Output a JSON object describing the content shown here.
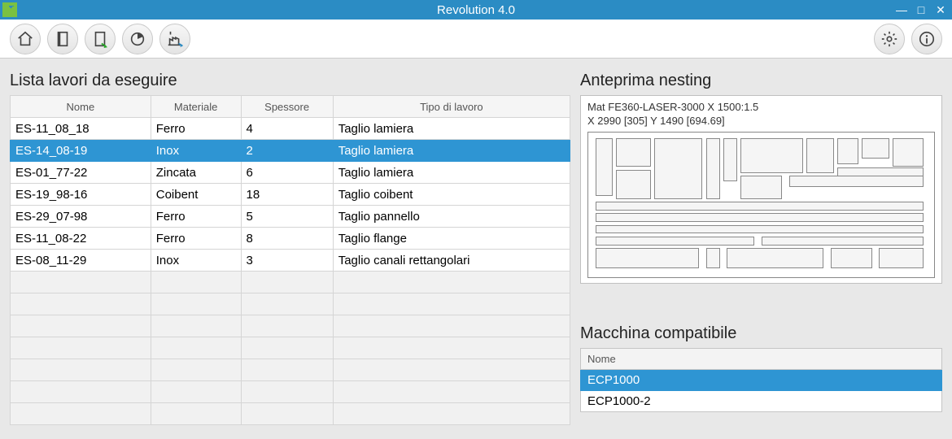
{
  "titlebar": {
    "title": "Revolution 4.0"
  },
  "left": {
    "title": "Lista lavori da eseguire",
    "headers": [
      "Nome",
      "Materiale",
      "Spessore",
      "Tipo di lavoro"
    ],
    "rows": [
      {
        "nome": "ES-11_08_18",
        "materiale": "Ferro",
        "spessore": "4",
        "tipo": "Taglio lamiera",
        "selected": false
      },
      {
        "nome": "ES-14_08-19",
        "materiale": "Inox",
        "spessore": "2",
        "tipo": "Taglio lamiera",
        "selected": true
      },
      {
        "nome": "ES-01_77-22",
        "materiale": "Zincata",
        "spessore": "6",
        "tipo": "Taglio lamiera",
        "selected": false
      },
      {
        "nome": "ES-19_98-16",
        "materiale": "Coibent",
        "spessore": "18",
        "tipo": "Taglio coibent",
        "selected": false
      },
      {
        "nome": "ES-29_07-98",
        "materiale": "Ferro",
        "spessore": "5",
        "tipo": "Taglio pannello",
        "selected": false
      },
      {
        "nome": "ES-11_08-22",
        "materiale": "Ferro",
        "spessore": "8",
        "tipo": "Taglio flange",
        "selected": false
      },
      {
        "nome": "ES-08_11-29",
        "materiale": "Inox",
        "spessore": "3",
        "tipo": "Taglio canali rettangolari",
        "selected": false
      }
    ],
    "empty_rows": 7
  },
  "preview": {
    "title": "Anteprima nesting",
    "line1": "Mat FE360-LASER-3000 X 1500:1.5",
    "line2": "X 2990 [305] Y 1490 [694.69]"
  },
  "machines": {
    "title": "Macchina compatibile",
    "header": "Nome",
    "rows": [
      {
        "name": "ECP1000",
        "selected": true
      },
      {
        "name": "ECP1000-2",
        "selected": false
      }
    ]
  }
}
